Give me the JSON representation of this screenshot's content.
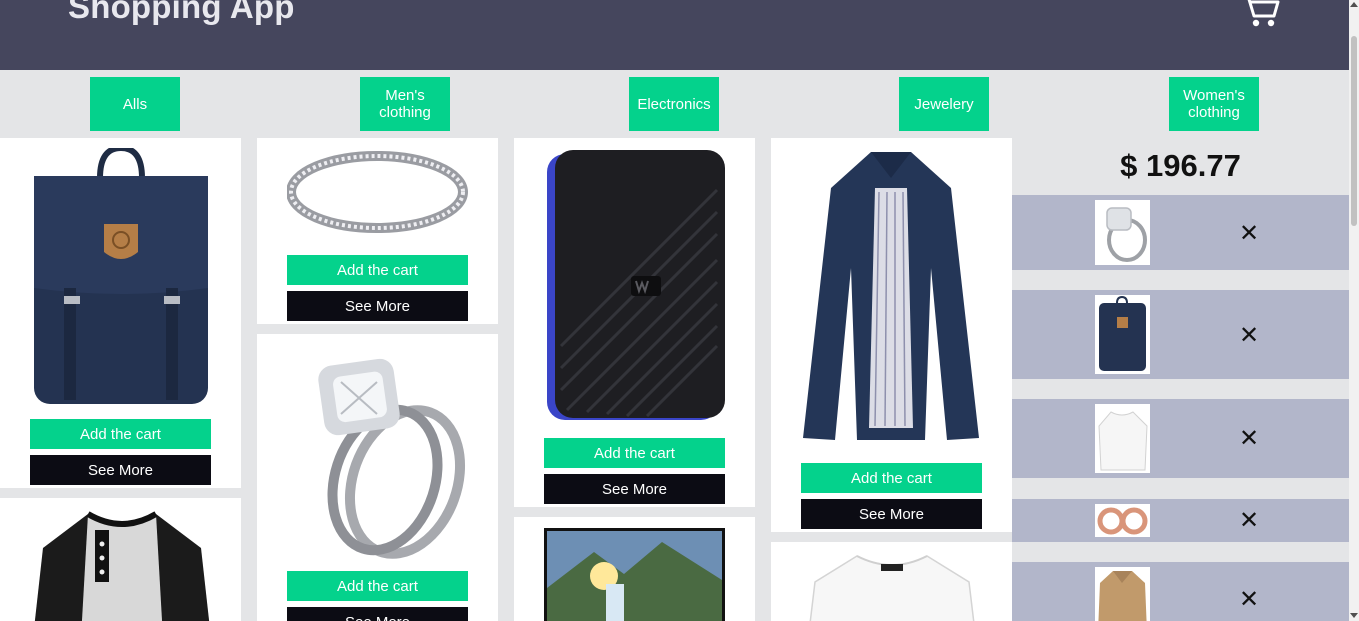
{
  "header": {
    "title": "Shopping App"
  },
  "categories": [
    "Alls",
    "Men's clothing",
    "Electronics",
    "Jewelery",
    "Women's clothing"
  ],
  "product_buttons": {
    "add": "Add the cart",
    "more": "See More"
  },
  "cart": {
    "total": "$ 196.77",
    "remove_glyph": "✕"
  },
  "colors": {
    "header": "#45465d",
    "accent": "#04d28c",
    "dark_button": "#0c0c14",
    "cart_row": "#b2b6ca"
  }
}
